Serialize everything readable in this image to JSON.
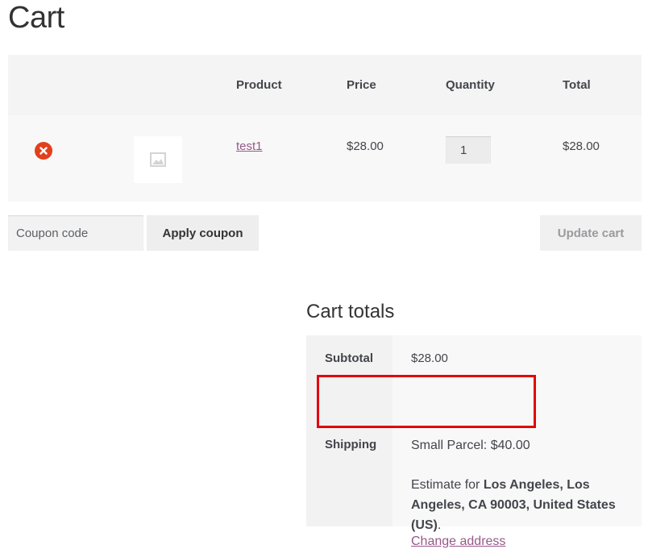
{
  "page": {
    "title": "Cart"
  },
  "cart_table": {
    "headers": {
      "product": "Product",
      "price": "Price",
      "quantity": "Quantity",
      "total": "Total"
    },
    "rows": [
      {
        "product": "test1",
        "price": "$28.00",
        "quantity": "1",
        "total": "$28.00",
        "remove_icon": "remove-x-icon",
        "thumbnail_icon": "image-placeholder-icon"
      }
    ]
  },
  "actions": {
    "coupon_placeholder": "Coupon code",
    "apply_label": "Apply coupon",
    "update_label": "Update cart"
  },
  "totals": {
    "title": "Cart totals",
    "subtotal_label": "Subtotal",
    "subtotal_value": "$28.00",
    "shipping_label": "Shipping",
    "shipping_value": "Small Parcel: $40.00",
    "estimate_prefix": "Estimate for ",
    "estimate_location": "Los Angeles, Los Angeles, CA 90003, United States (US)",
    "estimate_suffix": ".",
    "change_address": "Change address"
  },
  "colors": {
    "link": "#96588a",
    "remove": "#e2401c",
    "highlight": "#e3000f"
  }
}
